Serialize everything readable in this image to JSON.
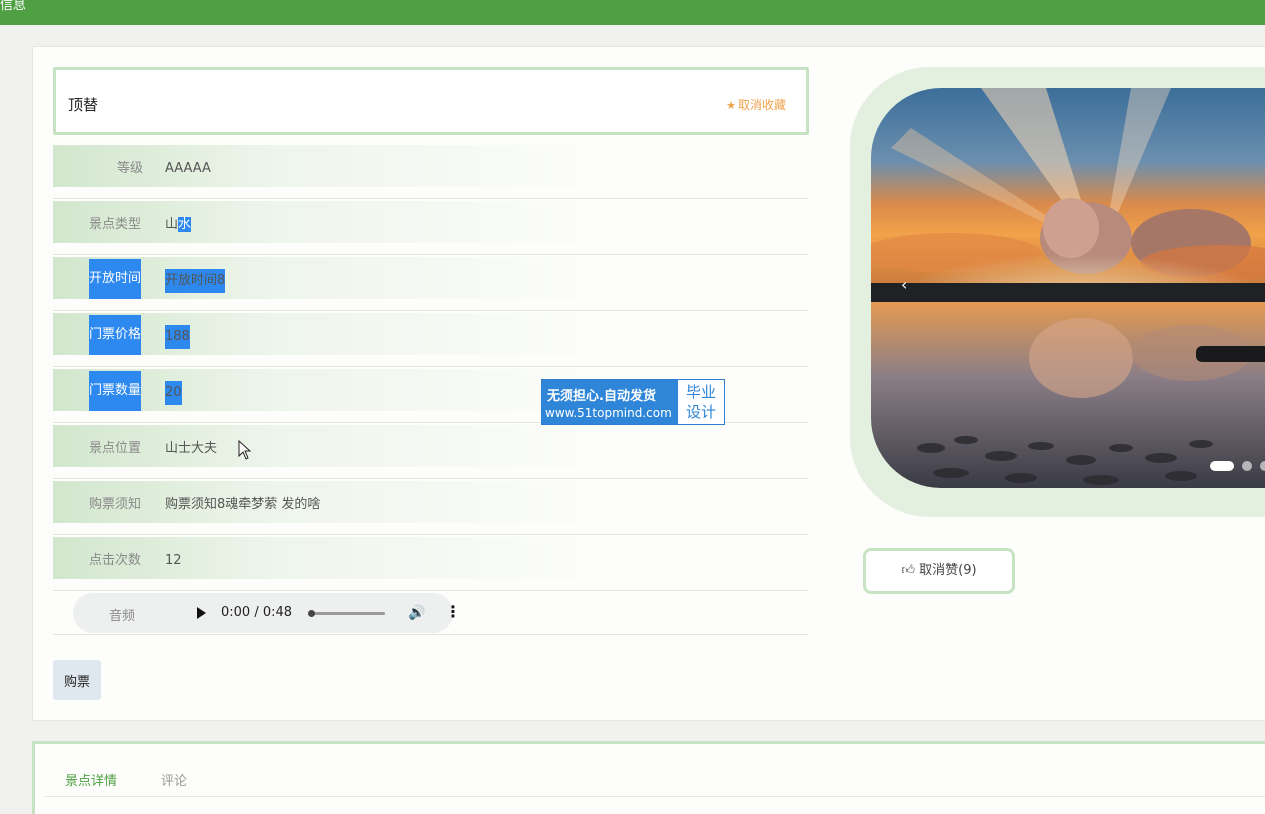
{
  "topbar": {
    "label": "信息"
  },
  "header": {
    "title": "顶替",
    "fav_label": "取消收藏",
    "fav_icon": "star-icon"
  },
  "fields": [
    {
      "label": "等级",
      "value": "AAAAA"
    },
    {
      "label": "景点类型",
      "value_plain": "山",
      "value_selected": "水"
    },
    {
      "label": "开放时间",
      "value": "开放时间8"
    },
    {
      "label": "门票价格",
      "value": "188"
    },
    {
      "label": "门票数量",
      "value": "20"
    },
    {
      "label": "景点位置",
      "value": "山士大夫"
    },
    {
      "label": "购票须知",
      "value": "购票须知8魂牵梦萦 发的啥"
    },
    {
      "label": "点击次数",
      "value": "12"
    }
  ],
  "audio": {
    "label": "音频",
    "time": "0:00 / 0:48",
    "progress_fraction": 0.0
  },
  "buy_button": "购票",
  "like_button": "取消赞(9)",
  "carousel": {
    "slides": 3,
    "active_index": 0
  },
  "watermark": {
    "line1": "无须担心.自动发货",
    "line2": "www.51topmind.com",
    "right_line1": "毕业",
    "right_line2": "设计"
  },
  "tabs": [
    {
      "label": "景点详情",
      "active": true
    },
    {
      "label": "评论",
      "active": false
    }
  ],
  "colors": {
    "header_green": "#4fa043",
    "border_green": "#c7e3c3",
    "fav_orange": "#f0a34c",
    "selection_blue": "#2d89ef"
  }
}
